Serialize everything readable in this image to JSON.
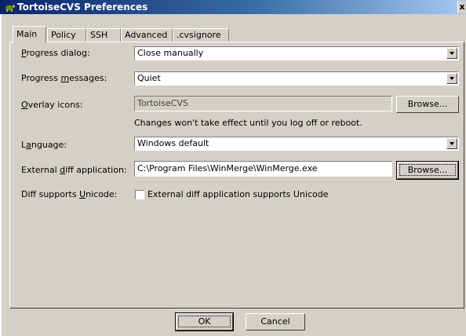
{
  "window": {
    "title": "TortoiseCVS Preferences",
    "close_label": "x"
  },
  "tabs": [
    {
      "label": "Main",
      "active": true
    },
    {
      "label": "Policy",
      "active": false
    },
    {
      "label": "SSH",
      "active": false
    },
    {
      "label": "Advanced",
      "active": false
    },
    {
      "label": ".cvsignore",
      "active": false
    }
  ],
  "form": {
    "progress_dialog": {
      "label": "rogress dialog:",
      "accel": "P",
      "value": "Close manually"
    },
    "progress_messages": {
      "label_pre": "Progress ",
      "accel": "m",
      "label_post": "essages:",
      "value": "Quiet"
    },
    "overlay_icons": {
      "accel": "O",
      "label": "verlay icons:",
      "value": "TortoiseCVS",
      "browse_label": "Browse..."
    },
    "overlay_note": "Changes won't take effect until you log off or reboot.",
    "language": {
      "label_pre": "L",
      "accel": "a",
      "label_post": "nguage:",
      "value": "Windows default"
    },
    "external_diff": {
      "label_pre": "External ",
      "accel": "d",
      "label_post": "iff application:",
      "value": "C:\\Program Files\\WinMerge\\WinMerge.exe",
      "browse_label": "Browse..."
    },
    "diff_unicode": {
      "label_pre": "Diff supports ",
      "accel": "U",
      "label_post": "nicode:",
      "checkbox_label": "External diff application supports Unicode",
      "checked": false
    }
  },
  "buttons": {
    "ok": "OK",
    "cancel": "Cancel"
  }
}
